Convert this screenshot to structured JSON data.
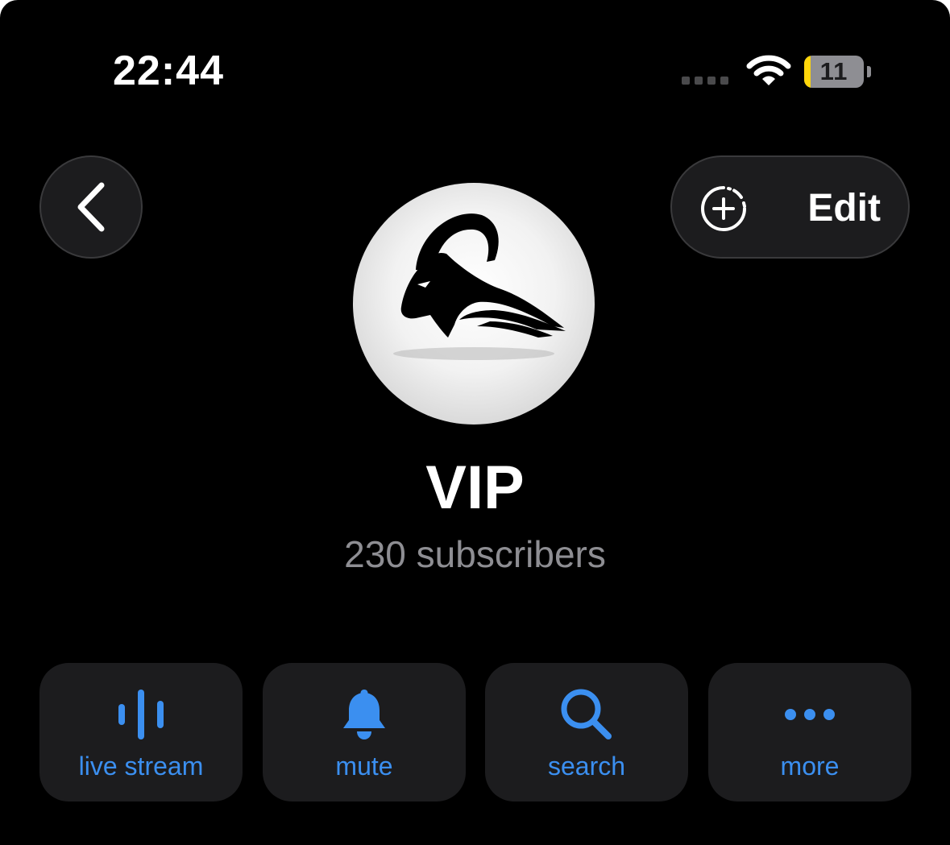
{
  "status_bar": {
    "time": "22:44",
    "battery_level": "11",
    "battery_fraction": 0.11,
    "icons": [
      "cellular-signal-icon",
      "wifi-icon",
      "battery-icon"
    ]
  },
  "nav": {
    "back_icon": "chevron-left-icon",
    "add_story_icon": "add-story-icon",
    "edit_label": "Edit"
  },
  "channel": {
    "name": "VIP",
    "subscribers": "230 subscribers"
  },
  "actions": [
    {
      "label": "live stream",
      "icon": "live-stream-icon"
    },
    {
      "label": "mute",
      "icon": "bell-icon"
    },
    {
      "label": "search",
      "icon": "search-icon"
    },
    {
      "label": "more",
      "icon": "more-dots-icon"
    }
  ],
  "colors": {
    "background": "#000000",
    "surface": "#1c1c1e",
    "accent": "#3b8ff0",
    "secondary_text": "#8e8e93",
    "battery_low": "#ffd60a"
  }
}
